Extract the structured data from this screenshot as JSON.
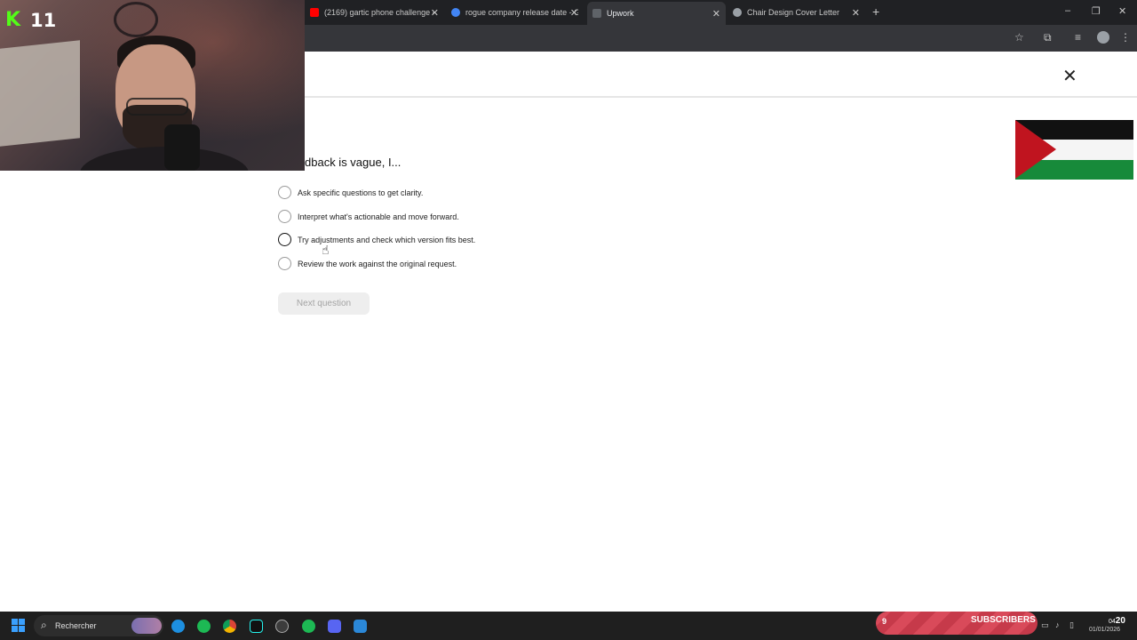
{
  "browser": {
    "tabs": [
      {
        "title": "(2169) gartic phone challenge -",
        "favicon_color": "#ff0000",
        "active": false
      },
      {
        "title": "rogue company release date - G",
        "favicon_color": "#4285f4",
        "active": false
      },
      {
        "title": "Upwork",
        "favicon_color": "#1f1f1f",
        "active": true
      },
      {
        "title": "Chair Design Cover Letter",
        "favicon_color": "#9aa0a6",
        "active": false
      }
    ],
    "new_tab": "+",
    "window_controls": [
      "–",
      "❐",
      "✕"
    ]
  },
  "quiz": {
    "question": "dback is vague, I...",
    "options": [
      "Ask specific questions to get clarity.",
      "Interpret what's actionable and move forward.",
      "Try adjustments and check which version fits best.",
      "Review the work against the original request."
    ],
    "next_button": "Next question",
    "close_glyph": "✕"
  },
  "webcam": {
    "platform_logo": "K",
    "number": "11"
  },
  "taskbar": {
    "search_placeholder": "Rechercher",
    "apps": [
      "edge-icon",
      "spotify-icon",
      "chrome-icon",
      "tiktok-icon",
      "app-icon",
      "spotify-icon",
      "discord-icon",
      "app-icon"
    ],
    "subscribers_count": "9",
    "subscribers_label": "SUBSCRIBERS",
    "clock_hour": "04",
    "clock_minute": "20",
    "clock_date": "01/01/2026"
  },
  "colors": {
    "accent_kick": "#53fc18",
    "flag_black": "#111111",
    "flag_white": "#f5f5f5",
    "flag_green": "#178a3a",
    "flag_red": "#c0141f"
  }
}
